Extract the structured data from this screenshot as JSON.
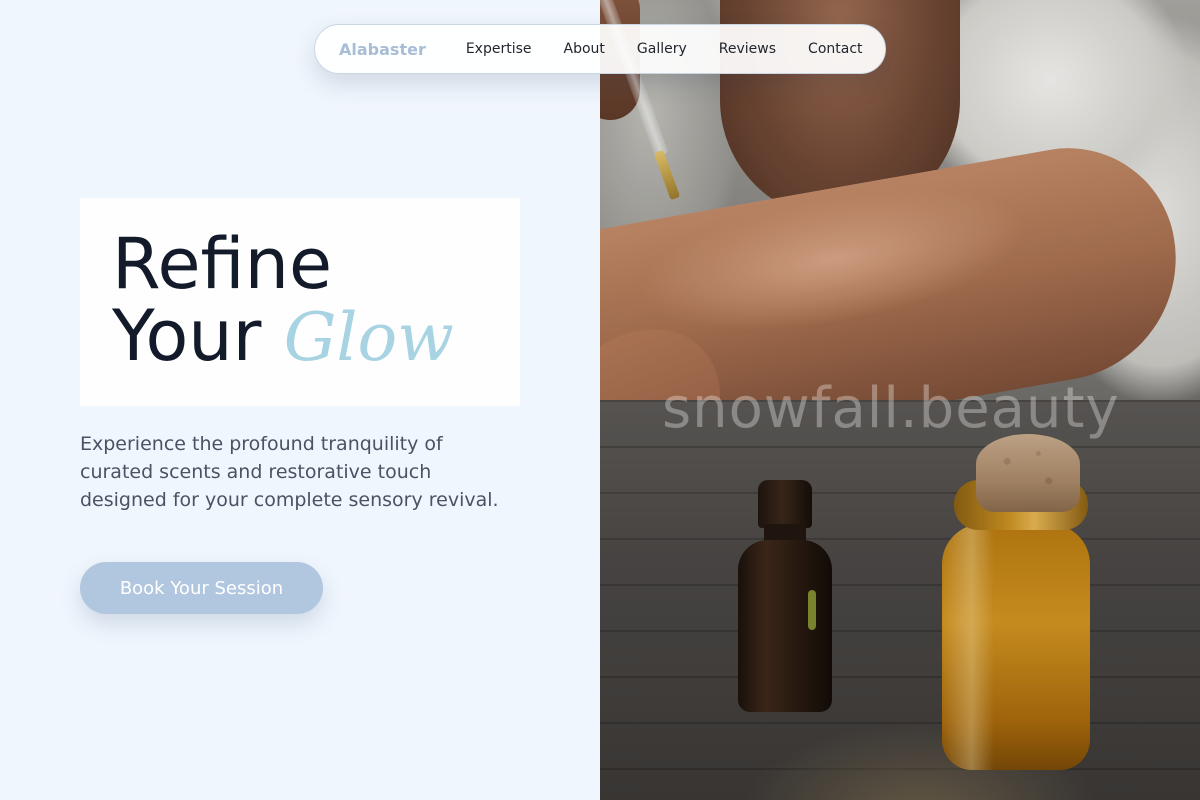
{
  "nav": {
    "brand": "Alabaster",
    "links": [
      "Expertise",
      "About",
      "Gallery",
      "Reviews",
      "Contact"
    ]
  },
  "hero": {
    "headline_line1": "Refine",
    "headline_line2": "Your",
    "headline_accent": "Glow",
    "lead": "Experience the profound tranquility of curated scents and restorative touch designed for your complete sensory revival.",
    "cta_label": "Book Your Session"
  },
  "watermark": "snowfall.beauty",
  "colors": {
    "background": "#f0f6fd",
    "brand": "#a9bdd6",
    "accent": "#a7d3e2",
    "cta": "#b1c7e0",
    "heading": "#131a2a",
    "body_text": "#4a5363"
  }
}
